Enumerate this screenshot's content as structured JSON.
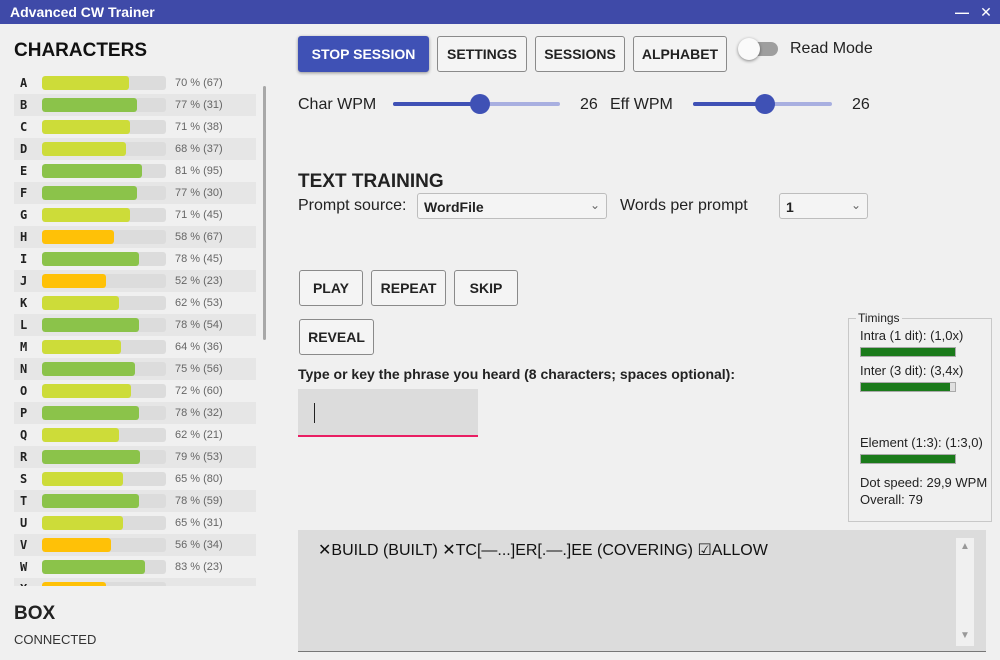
{
  "window": {
    "title": "Advanced CW Trainer",
    "minimize_glyph": "—",
    "close_glyph": "✕"
  },
  "left_panel": {
    "characters_title": "CHARACTERS",
    "characters": [
      {
        "letter": "A",
        "pct": 70,
        "stat": "70 % (67)"
      },
      {
        "letter": "B",
        "pct": 77,
        "stat": "77 % (31)"
      },
      {
        "letter": "C",
        "pct": 71,
        "stat": "71 % (38)"
      },
      {
        "letter": "D",
        "pct": 68,
        "stat": "68 % (37)"
      },
      {
        "letter": "E",
        "pct": 81,
        "stat": "81 % (95)"
      },
      {
        "letter": "F",
        "pct": 77,
        "stat": "77 % (30)"
      },
      {
        "letter": "G",
        "pct": 71,
        "stat": "71 % (45)"
      },
      {
        "letter": "H",
        "pct": 58,
        "stat": "58 % (67)"
      },
      {
        "letter": "I",
        "pct": 78,
        "stat": "78 % (45)"
      },
      {
        "letter": "J",
        "pct": 52,
        "stat": "52 % (23)"
      },
      {
        "letter": "K",
        "pct": 62,
        "stat": "62 % (53)"
      },
      {
        "letter": "L",
        "pct": 78,
        "stat": "78 % (54)"
      },
      {
        "letter": "M",
        "pct": 64,
        "stat": "64 % (36)"
      },
      {
        "letter": "N",
        "pct": 75,
        "stat": "75 % (56)"
      },
      {
        "letter": "O",
        "pct": 72,
        "stat": "72 % (60)"
      },
      {
        "letter": "P",
        "pct": 78,
        "stat": "78 % (32)"
      },
      {
        "letter": "Q",
        "pct": 62,
        "stat": "62 % (21)"
      },
      {
        "letter": "R",
        "pct": 79,
        "stat": "79 % (53)"
      },
      {
        "letter": "S",
        "pct": 65,
        "stat": "65 % (80)"
      },
      {
        "letter": "T",
        "pct": 78,
        "stat": "78 % (59)"
      },
      {
        "letter": "U",
        "pct": 65,
        "stat": "65 % (31)"
      },
      {
        "letter": "V",
        "pct": 56,
        "stat": "56 % (34)"
      },
      {
        "letter": "W",
        "pct": 83,
        "stat": "83 % (23)"
      },
      {
        "letter": "X",
        "pct": 52,
        "stat": ""
      }
    ],
    "box_title": "BOX",
    "box_status": "CONNECTED"
  },
  "colors": {
    "good": "#8bc34a",
    "mid": "#cddc39",
    "weak": "#ffc107"
  },
  "toolbar": {
    "stop_session": "STOP SESSION",
    "settings": "SETTINGS",
    "sessions": "SESSIONS",
    "alphabet": "ALPHABET",
    "read_mode_label": "Read Mode",
    "read_mode_on": false
  },
  "speed": {
    "char_wpm_label": "Char WPM",
    "char_wpm": "26",
    "char_wpm_level": 0.52,
    "eff_wpm_label": "Eff WPM",
    "eff_wpm": "26",
    "eff_wpm_level": 0.52
  },
  "training": {
    "title": "TEXT TRAINING",
    "prompt_source_label": "Prompt source:",
    "prompt_source_value": "WordFile",
    "words_per_prompt_label": "Words per prompt",
    "words_per_prompt_value": "1",
    "play": "PLAY",
    "repeat": "REPEAT",
    "skip": "SKIP",
    "reveal": "REVEAL",
    "phrase_label": "Type or key the phrase you heard (8 characters; spaces optional):",
    "phrase_value": ""
  },
  "timings": {
    "legend": "Timings",
    "intra_label": "Intra (1 dit): (1,0x)",
    "intra_level": 1.0,
    "inter_label": "Inter (3 dit):  (3,4x)",
    "inter_level": 0.95,
    "element_label": "Element (1:3): (1:3,0)",
    "element_level": 1.0,
    "dot_speed": "Dot speed: 29,9 WPM",
    "overall": "Overall: 79"
  },
  "output": {
    "text": "✕BUILD (BUILT) ✕TC[—...]ER[.—.]EE (COVERING) ☑ALLOW",
    "scroll_up": "▲",
    "scroll_down": "▼"
  }
}
